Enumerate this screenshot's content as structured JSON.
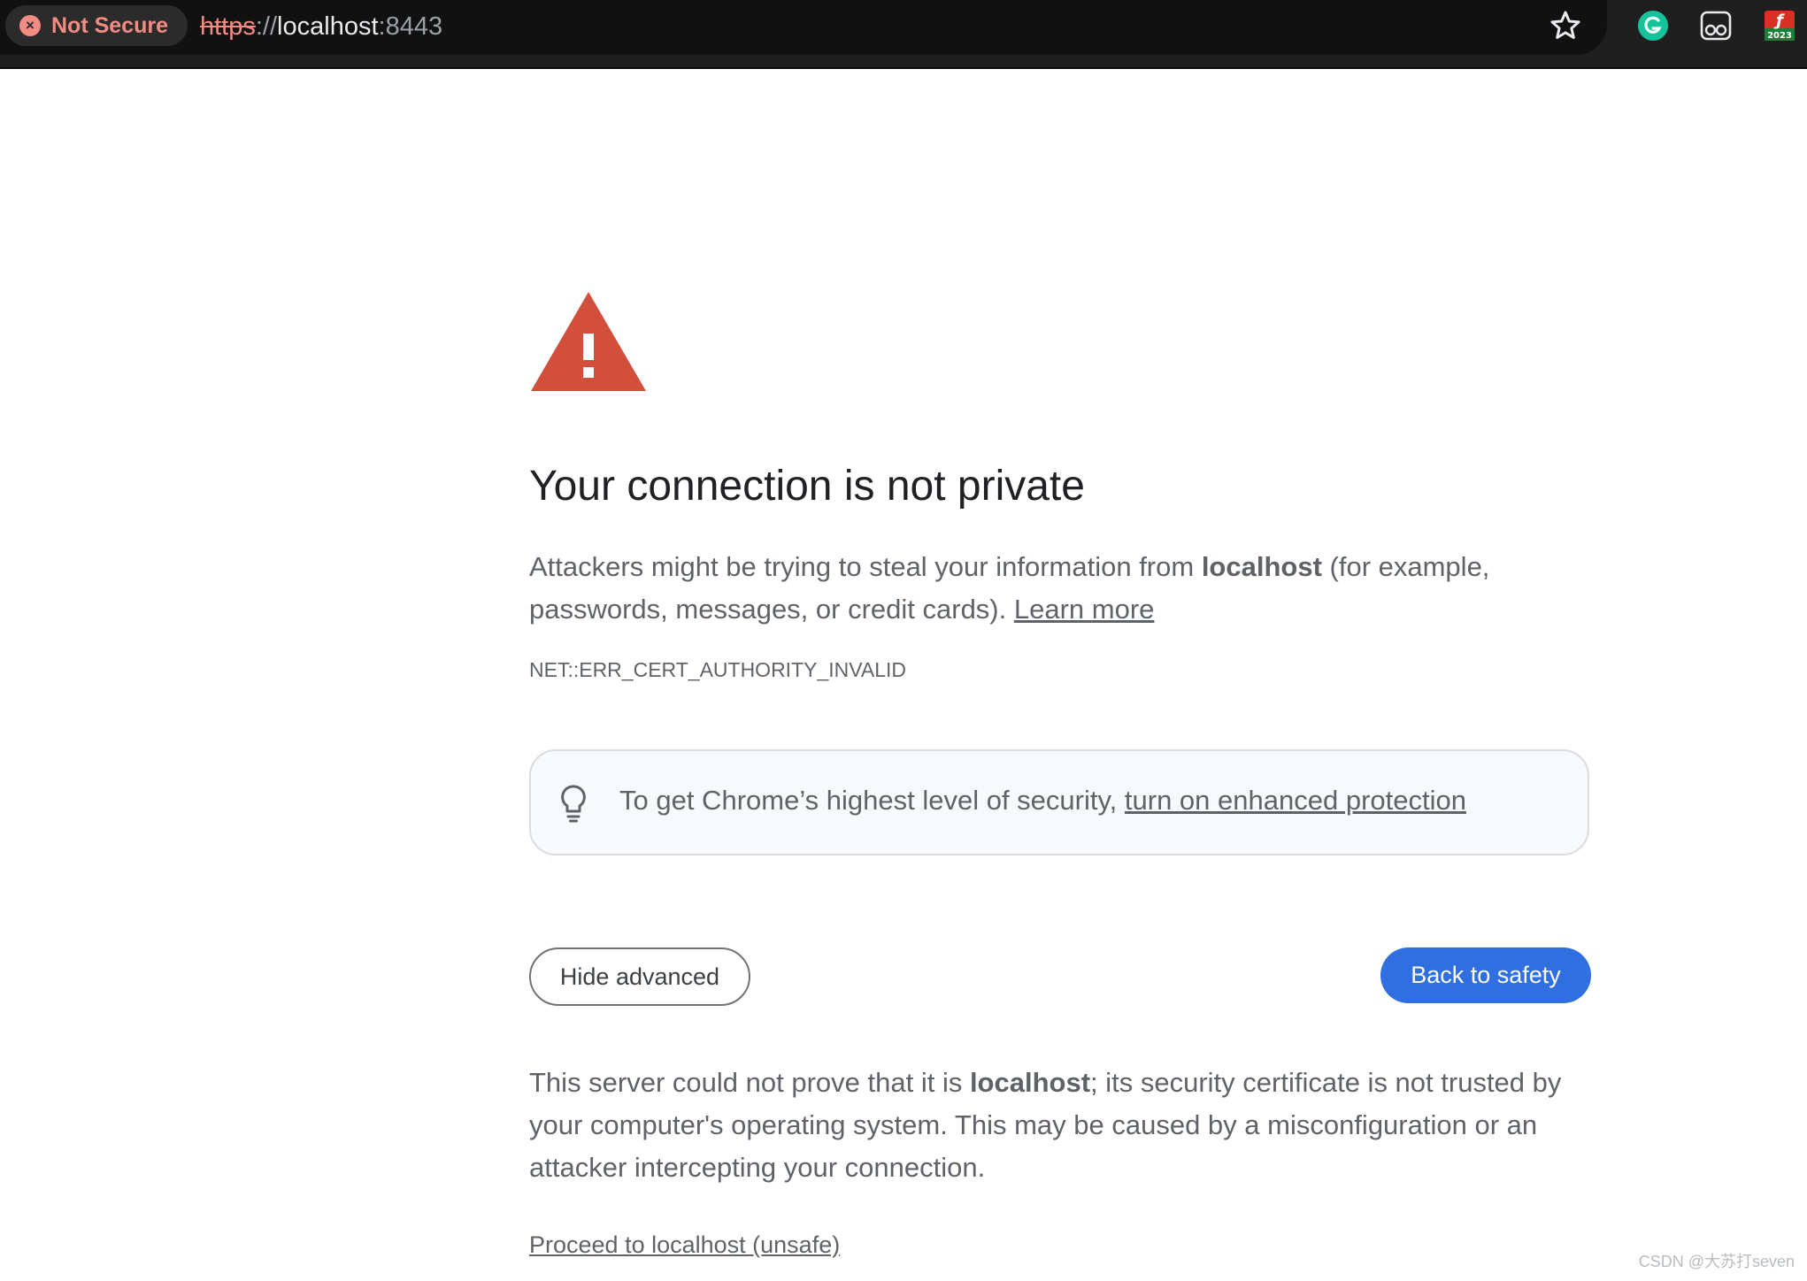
{
  "browser": {
    "security_chip": "Not Secure",
    "url": {
      "scheme": "https",
      "separator": "://",
      "host": "localhost",
      "port": ":8443"
    },
    "icons": {
      "bookmark": "star-icon",
      "extension_1": "grammarly-icon",
      "extension_2": "glasses-icon",
      "extension_3": "red-extension-icon"
    }
  },
  "page": {
    "heading": "Your connection is not private",
    "intro": {
      "before_host": "Attackers might be trying to steal your information from ",
      "host": "localhost",
      "after_host": " (for example, passwords, messages, or credit cards). ",
      "learn_more": "Learn more"
    },
    "error_code": "NET::ERR_CERT_AUTHORITY_INVALID",
    "enhanced": {
      "text": "To get Chrome’s highest level of security, ",
      "link": "turn on enhanced protection"
    },
    "buttons": {
      "hide_advanced": "Hide advanced",
      "back_to_safety": "Back to safety"
    },
    "details": {
      "before_host": "This server could not prove that it is ",
      "host": "localhost",
      "after_host": "; its security certificate is not trusted by your computer's operating system. This may be caused by a misconfiguration or an attacker intercepting your connection."
    },
    "proceed_link": "Proceed to localhost (unsafe)"
  },
  "watermark": "CSDN @大苏打seven",
  "colors": {
    "warning_red": "#d24f3b",
    "primary_blue": "#2f6fdf",
    "insecure_red": "#f28b82",
    "body_text": "#5f6368"
  }
}
